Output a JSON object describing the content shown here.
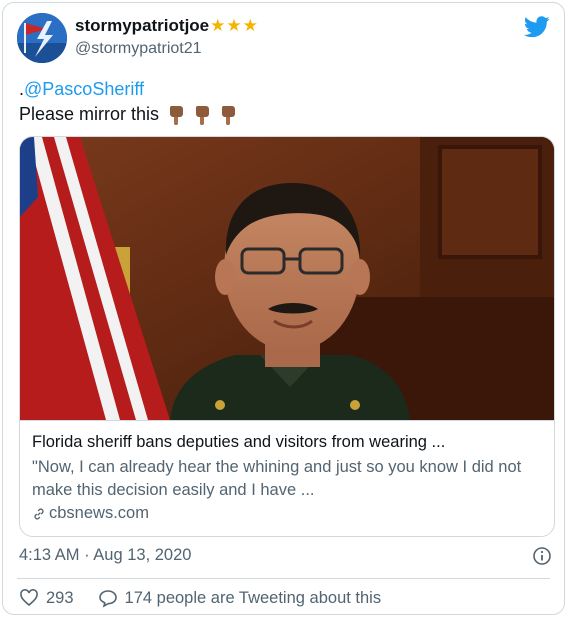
{
  "author": {
    "display_name": "stormypatriotjoe",
    "badge": "★★★",
    "handle": "@stormypatriot21",
    "avatar_icon": "lightning-flag-avatar"
  },
  "brand_icon": "twitter-bird-icon",
  "tweet": {
    "prefix": ".",
    "mention": "@PascoSheriff",
    "body": "Please mirror this",
    "emoji_icon": "pointing-down-hand-icon"
  },
  "card": {
    "image_alt": "sheriff-portrait",
    "title": "Florida sheriff bans deputies and visitors from wearing ...",
    "description": "\"Now, I can already hear the whining and just so you know I did not make this decision easily and I have ...",
    "domain": "cbsnews.com"
  },
  "meta": {
    "timestamp": "4:13 AM · Aug 13, 2020"
  },
  "actions": {
    "likes": "293",
    "replies": "174 people are Tweeting about this"
  },
  "colors": {
    "accent": "#1d9bf0",
    "secondary_text": "#536471",
    "border": "#cfd9de",
    "star": "#f4b400"
  }
}
